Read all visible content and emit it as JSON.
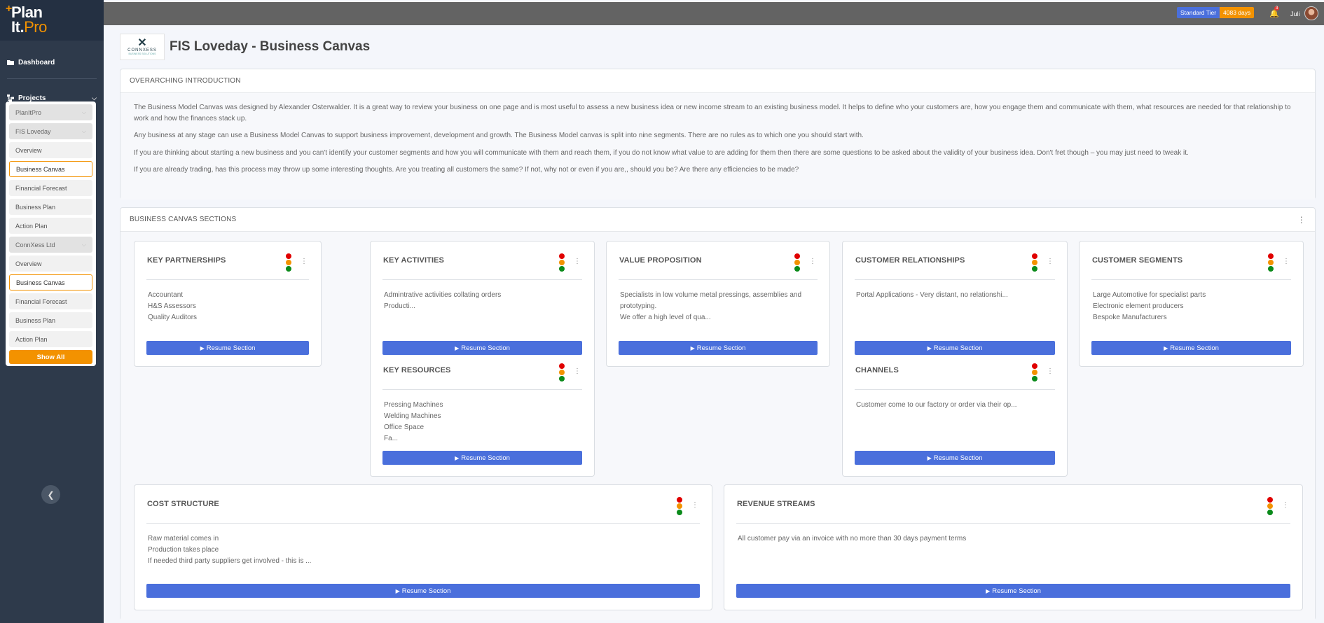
{
  "logo": {
    "plus": "+",
    "line1": "Plan",
    "line2_white": "It.",
    "line2_orange": "Pro"
  },
  "sidebar": {
    "dashboard": "Dashboard",
    "projects": "Projects",
    "rows": [
      "PlanItPro",
      "FIS Loveday",
      "Overview",
      "Business Canvas",
      "Financial Forecast",
      "Business Plan",
      "Action Plan",
      "ConnXess Ltd",
      "Overview",
      "Business Canvas",
      "Financial Forecast",
      "Business Plan",
      "Action Plan"
    ],
    "show_all": "Show All"
  },
  "topbar": {
    "tier": "Standard Tier",
    "days": "4083 days",
    "notifications": "3",
    "user": "Juli"
  },
  "company_logo": {
    "mark": "✕",
    "name": "CONNXESS",
    "tagline": "BUSINESS SOLUTIONS"
  },
  "page": {
    "title": "FIS Loveday - Business Canvas"
  },
  "intro": {
    "heading": "OVERARCHING INTRODUCTION",
    "p1": "The Business Model Canvas was designed by Alexander Osterwalder. It is a great way to review your business on one page and is most useful to assess a new business idea or new income stream to an existing business model. It helps to define who your customers are, how you engage them and communicate with them, what resources are needed for that relationship to work and how the finances stack up.",
    "p2": "Any business at any stage can use a Business Model Canvas to support business improvement, development and growth. The Business Model canvas is split into nine segments. There are no rules as to which one you should start with.",
    "p3": "If you are thinking about starting a new business and you can't identify your customer segments and how you will communicate with them and reach them, if you do not know what value to are adding for them then there are some questions to be asked about the validity of your business idea. Don't fret though – you may just need to tweak it.",
    "p4": "If you are already trading, has this process may throw up some interesting thoughts. Are you treating all customers the same? If not, why not or even if you are,, should you be? Are there any efficiencies to be made?"
  },
  "sections": {
    "heading": "BUSINESS CANVAS SECTIONS",
    "resume_label": "Resume Section",
    "key_partnerships": {
      "title": "KEY PARTNERSHIPS",
      "lines": [
        "Accountant",
        "H&S Assessors",
        "Quality Auditors"
      ]
    },
    "key_activities": {
      "title": "KEY ACTIVITIES",
      "lines": [
        "Admintrative activities collating orders",
        "Producti..."
      ]
    },
    "key_resources": {
      "title": "KEY RESOURCES",
      "lines": [
        "Pressing Machines",
        "Welding Machines",
        "Office Space",
        "Fa..."
      ]
    },
    "value_proposition": {
      "title": "VALUE PROPOSITION",
      "lines": [
        "Specialists in  low volume metal pressings, assemblies and",
        "prototyping.",
        "We offer a high level of qua..."
      ]
    },
    "customer_relationships": {
      "title": "CUSTOMER RELATIONSHIPS",
      "lines": [
        "Portal Applications - Very distant, no relationshi..."
      ]
    },
    "channels": {
      "title": "CHANNELS",
      "lines": [
        "Customer come to our factory or order via their op..."
      ]
    },
    "customer_segments": {
      "title": "CUSTOMER SEGMENTS",
      "lines": [
        "Large Automotive for specialist parts",
        "Electronic element producers",
        "Bespoke Manufacturers"
      ]
    },
    "cost_structure": {
      "title": "COST STRUCTURE",
      "lines": [
        "Raw material comes in",
        "Production takes place",
        "If needed third party suppliers get involved - this is ..."
      ]
    },
    "revenue_streams": {
      "title": "REVENUE STREAMS",
      "lines": [
        "All customer pay via an invoice with no more than 30 days payment terms"
      ]
    }
  },
  "colors": {
    "sidebar": "#2e3a4b",
    "accent_orange": "#f39200",
    "button_blue": "#4a6fdc",
    "rag_red": "#e00000",
    "rag_amber": "#f39200",
    "rag_green": "#0a8a1a"
  }
}
